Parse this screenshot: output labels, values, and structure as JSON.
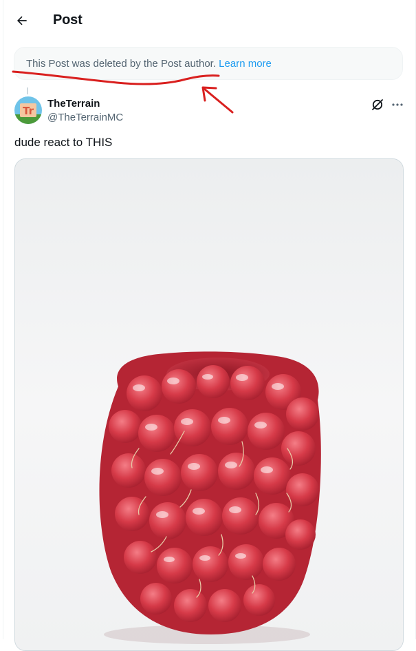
{
  "header": {
    "back_icon": "arrow-left-icon",
    "title": "Post"
  },
  "notice": {
    "text": "This Post was deleted by the Post author.",
    "link": "Learn more"
  },
  "annotation": {
    "color": "#d9201f",
    "shapes": [
      "underline",
      "arrow"
    ]
  },
  "post": {
    "author": {
      "display_name": "TheTerrain",
      "handle": "@TheTerrainMC",
      "avatar_letters": "Tr"
    },
    "actions": {
      "grok_icon": "grok-icon",
      "more_icon": "more-horizontal-icon"
    },
    "text": "dude react to THIS",
    "media": {
      "subject": "raspberry on white background"
    }
  },
  "colors": {
    "text": "#0f1419",
    "secondary": "#536471",
    "link": "#1d9bf0",
    "border": "#eff3f4",
    "raspberry": "#d63a48"
  }
}
